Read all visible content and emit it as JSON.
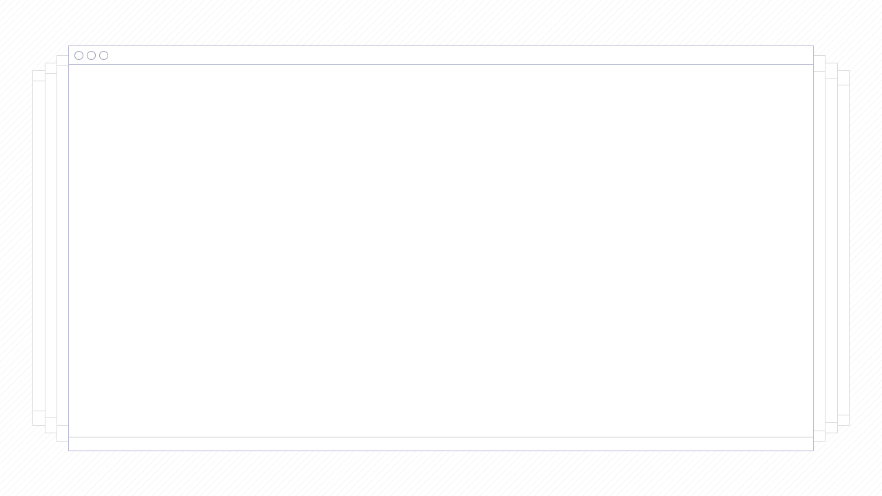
{
  "window": {
    "title": "",
    "status_text": "",
    "controls": [
      "window-control-icon",
      "window-control-icon",
      "window-control-icon"
    ]
  },
  "theme": {
    "window_border": "#b7b9d4",
    "stack_border": "#dadada",
    "background": "#ffffff"
  }
}
